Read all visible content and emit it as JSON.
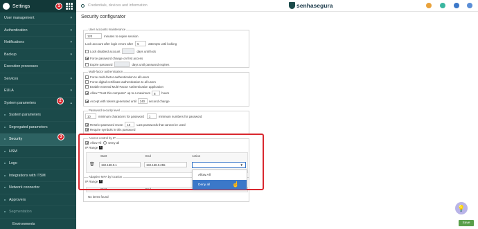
{
  "sidebar": {
    "title": "Settings",
    "items": [
      {
        "label": "User management"
      },
      {
        "label": "Authentication"
      },
      {
        "label": "Notifications"
      },
      {
        "label": "Backup"
      },
      {
        "label": "Execution processes"
      },
      {
        "label": "Services"
      },
      {
        "label": "EULA"
      },
      {
        "label": "System parameters"
      }
    ],
    "subitems": [
      {
        "label": "System parameters"
      },
      {
        "label": "Segregated parameters"
      },
      {
        "label": "Security"
      },
      {
        "label": "HSM"
      },
      {
        "label": "Logo"
      },
      {
        "label": "Integrations with ITSM"
      },
      {
        "label": "Network connector"
      },
      {
        "label": "Approvers"
      },
      {
        "label": "Segmentation"
      },
      {
        "label": "Environments"
      }
    ]
  },
  "badges": [
    "1",
    "2",
    "3"
  ],
  "topbar": {
    "search_text": "Credentials, devices and information",
    "brand": "senhasegura"
  },
  "page_title": "Security configurator",
  "user_accounts": {
    "legend": "User accounts maintenance",
    "expire_value": "120",
    "expire_text": "minutes to expire session",
    "lock_text": "Lock account after login errors after",
    "lock_value": "5",
    "lock_suffix": "attempts until locking",
    "lock_disabled_label": "Lock disabled account",
    "lock_disabled_suffix": "days until lock",
    "force_pw_label": "Force password change on first access",
    "expire_pw_label": "Expire password",
    "expire_pw_suffix": "days until password expires"
  },
  "mfa": {
    "legend": "Multi-factor authentication",
    "opt1": "Force multi-factor authentication to all users",
    "opt2": "Force digital certificate authentication to all users",
    "opt3": "Enable external Multi-Factor Authentication application",
    "opt4": "Allow \"Trust this computer\" up to a maximum",
    "opt4_value": "8",
    "opt4_suffix": "hours",
    "opt5": "Accept with tokens generated until",
    "opt5_value": "240",
    "opt5_suffix": "second change"
  },
  "password": {
    "legend": "Password security level",
    "min_chars_value": "10",
    "min_chars_text": "minimum characters for password",
    "min_numbers_value": "1",
    "min_numbers_text": "minimum numbers for password",
    "restrict_label": "Restrict password reuse:",
    "restrict_value": "10",
    "restrict_suffix": "Last passwords that cannot be used",
    "require_symbols": "Require symbols in this password"
  },
  "access_control": {
    "legend": "Access control by IP",
    "allow_all": "Allow All",
    "deny_all": "Deny all",
    "ip_range": "IP Range",
    "col_start": "Start",
    "col_end": "End",
    "col_action": "Action",
    "start_ip": "192.168.0.1",
    "end_ip": "192.168.0.255",
    "dropdown_options": [
      "Allow All",
      "Deny all"
    ]
  },
  "adaptive": {
    "legend": "Adaptive MFA by location",
    "ip_range": "IP Range",
    "col_start": "Start",
    "col_end": "End",
    "col_action": "Action",
    "empty": "No items found"
  },
  "save_label": "Save"
}
